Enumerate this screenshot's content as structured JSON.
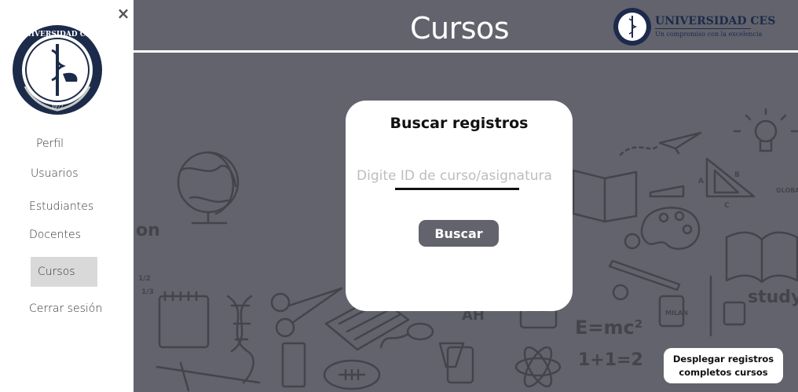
{
  "sidebar": {
    "close_icon": "×",
    "logo": {
      "name": "UNIVERSIDAD CES",
      "year": "1977"
    },
    "items": [
      {
        "label": "Perfil"
      },
      {
        "label": "Usuarios"
      },
      {
        "label": "Estudiantes"
      },
      {
        "label": "Docentes"
      },
      {
        "label": "Cursos",
        "active": true
      },
      {
        "label": "Cerrar sesión"
      }
    ]
  },
  "header": {
    "title": "Cursos",
    "brand_name": "UNIVERSIDAD CES",
    "brand_tagline": "Un compromiso con la excelencia"
  },
  "background_doodles": {
    "texts": [
      "on",
      "study",
      "E=mc²",
      "1+1=2",
      "AH",
      "MILAN",
      "GLOBAL",
      "A",
      "B",
      "C",
      "1/2",
      "1/3"
    ]
  },
  "search_card": {
    "title": "Buscar registros",
    "input_placeholder": "Digite ID de curso/asignatura",
    "input_value": "",
    "button_label": "Buscar"
  },
  "records_button": {
    "line1": "Desplegar registros",
    "line2": "completos cursos"
  },
  "colors": {
    "main_bg": "#63636d",
    "brand_navy": "#1c2b4a",
    "active_item": "#d9d9da"
  },
  "icons": [
    "close-icon",
    "university-seal-icon",
    "globe-icon",
    "lightbulb-icon",
    "paper-plane-icon",
    "triangle-ruler-icon",
    "palette-icon",
    "book-icon",
    "scissors-icon",
    "dna-icon",
    "keyboard-icon",
    "mouse-icon",
    "atom-icon",
    "football-icon",
    "pencil-icon"
  ]
}
